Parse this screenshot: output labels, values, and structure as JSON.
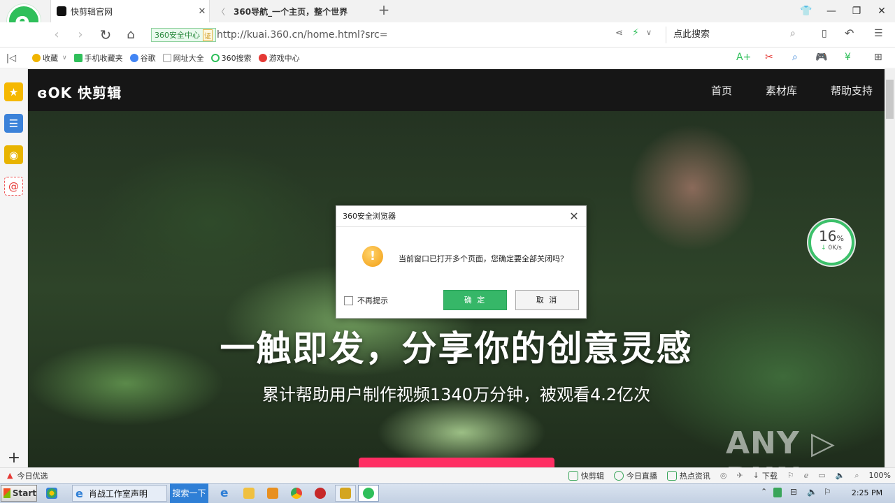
{
  "browser": {
    "tabs": [
      {
        "title": "快剪辑官网",
        "active": true
      },
      {
        "title": "360导航_一个主页，整个世界",
        "active": false
      }
    ],
    "address": {
      "security_badge": "360安全中心",
      "security_cert": "证",
      "url": "http://kuai.360.cn/home.html?src="
    },
    "search_placeholder": "点此搜索",
    "bookmarks": [
      {
        "label": "收藏",
        "color": "#f0b400"
      },
      {
        "label": "手机收藏夹",
        "color": "#2fbf5a"
      },
      {
        "label": "谷歌",
        "color": "#4285f4"
      },
      {
        "label": "网址大全",
        "color": "#999999"
      },
      {
        "label": "360搜索",
        "color": "#2fbf5a"
      },
      {
        "label": "游戏中心",
        "color": "#e53935"
      }
    ]
  },
  "site": {
    "logo": "ɞOK 快剪辑",
    "nav": [
      "首页",
      "素材库",
      "帮助支持"
    ],
    "hero_title": "一触即发，分享你的创意灵感",
    "hero_subtitle": "累计帮助用户制作视频1340万分钟，被观看4.2亿次",
    "watermark": "ANY ▷ RUN"
  },
  "speed_widget": {
    "percent": "16",
    "percent_unit": "%",
    "rate": "0K/s"
  },
  "dialog": {
    "title": "360安全浏览器",
    "message": "当前窗口已打开多个页面，您确定要全部关闭吗？",
    "checkbox_label": "不再提示",
    "ok_label": "确 定",
    "cancel_label": "取 消"
  },
  "statusbar": {
    "left": "今日优选",
    "items": [
      "快剪辑",
      "今日直播",
      "热点资讯",
      "下载"
    ],
    "zoom": "100%"
  },
  "taskbar": {
    "start_label": "Start",
    "window_label": "肖战工作室声明",
    "search_label": "搜索一下",
    "clock": "2:25 PM"
  }
}
